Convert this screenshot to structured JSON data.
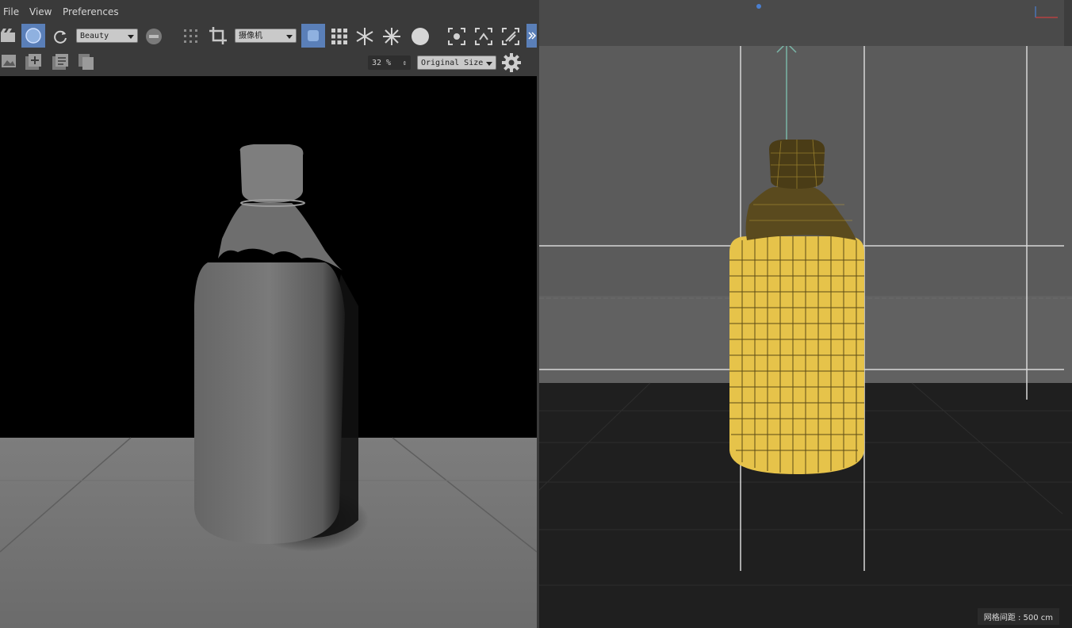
{
  "menu": {
    "file": "File",
    "view": "View",
    "preferences": "Preferences"
  },
  "toolbar": {
    "pass_select": "Beauty",
    "camera_select": "摄像机",
    "zoom_value": "32 %",
    "size_select": "Original Size"
  },
  "viewport": {
    "grid_spacing": "网格间距 : 500 cm"
  },
  "colors": {
    "accent": "#5a7fb8",
    "panel": "#3a3a3a",
    "wire": "#e8c84a"
  }
}
